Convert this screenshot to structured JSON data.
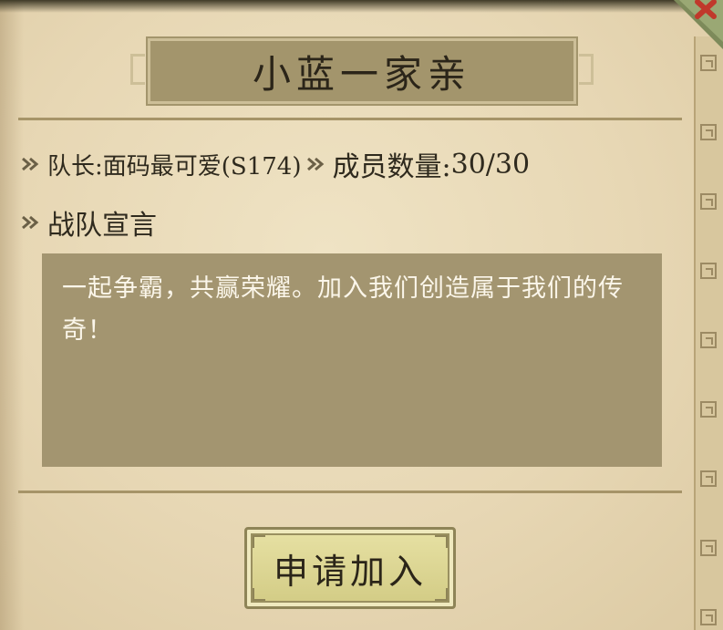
{
  "team": {
    "name": "小蓝一家亲"
  },
  "info": {
    "leader_label": "队长:",
    "leader_name": "面码最可爱(S174)",
    "members_label": "成员数量:",
    "members_count": "30/30"
  },
  "declaration": {
    "heading": "战队宣言",
    "text": "一起争霸，共赢荣耀。加入我们创造属于我们的传奇！"
  },
  "actions": {
    "apply_label": "申请加入"
  },
  "icons": {
    "bullet": "double-chevron-icon",
    "close": "close-x-icon"
  },
  "colors": {
    "parchment": "#e6d6b2",
    "plate": "#a3956c",
    "content_box": "#a39570",
    "button": "#dcd692",
    "close_red": "#c0392b"
  }
}
